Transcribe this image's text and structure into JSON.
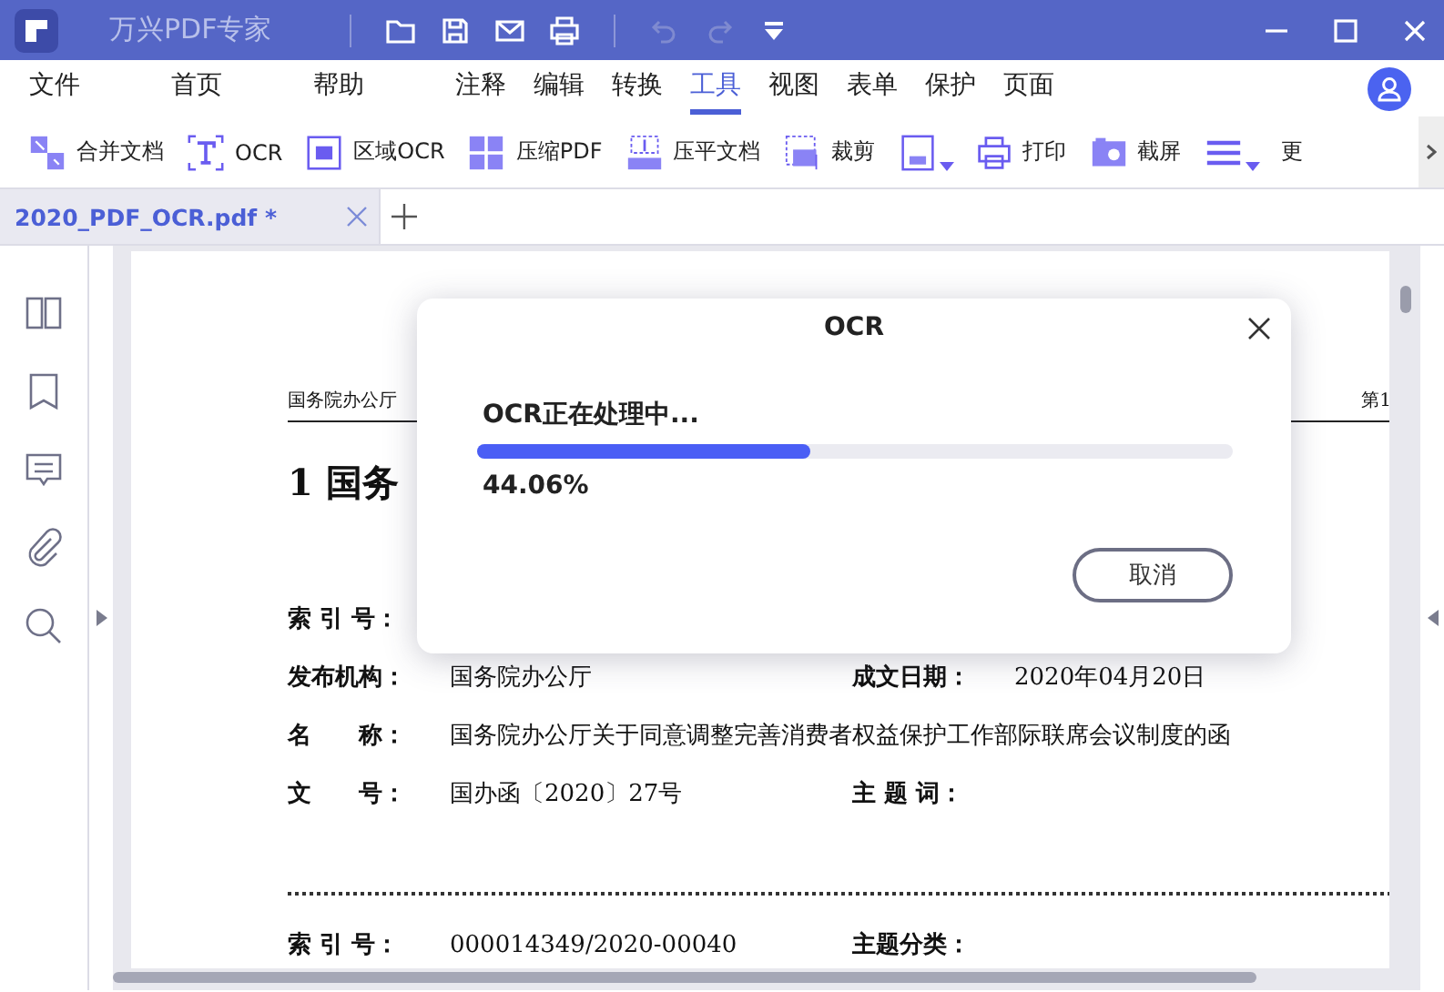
{
  "title_bar": {
    "app_name": "万兴PDF专家"
  },
  "menu": [
    {
      "label": "文件",
      "selected": false
    },
    {
      "label": "首页",
      "selected": false
    },
    {
      "label": "帮助",
      "selected": false
    },
    {
      "label": "注释",
      "selected": false
    },
    {
      "label": "编辑",
      "selected": false
    },
    {
      "label": "转换",
      "selected": false
    },
    {
      "label": "工具",
      "selected": true
    },
    {
      "label": "视图",
      "selected": false
    },
    {
      "label": "表单",
      "selected": false
    },
    {
      "label": "保护",
      "selected": false
    },
    {
      "label": "页面",
      "selected": false
    }
  ],
  "toolbar": [
    {
      "kind": "button",
      "label": "合并文档"
    },
    {
      "kind": "button",
      "label": "OCR"
    },
    {
      "kind": "button",
      "label": "区域OCR"
    },
    {
      "kind": "button",
      "label": "压缩PDF"
    },
    {
      "kind": "button",
      "label": "压平文档"
    },
    {
      "kind": "button",
      "label": "裁剪"
    },
    {
      "kind": "dropdown"
    },
    {
      "kind": "button",
      "label": "打印"
    },
    {
      "kind": "button",
      "label": "截屏"
    },
    {
      "kind": "dropdown"
    },
    {
      "kind": "button",
      "label": "更"
    }
  ],
  "tabs": [
    {
      "label": "2020_PDF_OCR.pdf *",
      "selected": true
    }
  ],
  "document": {
    "header_left": "国务院办公厅",
    "header_right": "第1",
    "heading": "1 国务",
    "rows": [
      {
        "label": "索 引 号："
      },
      {
        "label": "发布机构：",
        "value": "国务院办公厅",
        "label_2": "成文日期：",
        "value_2": "2020年04月20日"
      },
      {
        "label": "名　　称：",
        "value": "国务院办公厅关于同意调整完善消费者权益保护工作部际联席会议制度的函"
      },
      {
        "label": "文　　号：",
        "value": "国办函〔2020〕27号",
        "label_2": "主 题 词："
      }
    ],
    "next_rows": [
      {
        "label": "索 引 号：",
        "value": "000014349/2020-00040",
        "label_2": "主题分类："
      }
    ]
  },
  "dialog": {
    "title": "OCR",
    "message": "OCR正在处理中...",
    "level": 0.4406,
    "percent": "44.06%",
    "button": "取消"
  }
}
